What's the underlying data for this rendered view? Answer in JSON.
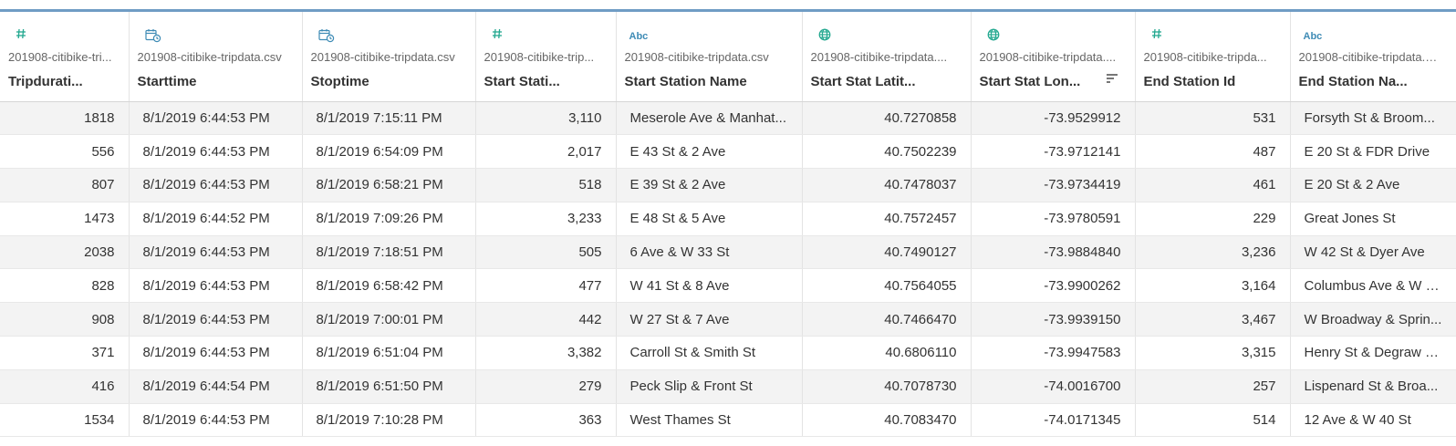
{
  "columns": [
    {
      "type": "number",
      "icon": "number-type-icon",
      "source": "201908-citibike-tri...",
      "name": "Tripdurati...",
      "align": "right"
    },
    {
      "type": "datetime",
      "icon": "datetime-type-icon",
      "source": "201908-citibike-tripdata.csv",
      "name": "Starttime",
      "align": "left"
    },
    {
      "type": "datetime",
      "icon": "datetime-type-icon",
      "source": "201908-citibike-tripdata.csv",
      "name": "Stoptime",
      "align": "left"
    },
    {
      "type": "number",
      "icon": "number-type-icon",
      "source": "201908-citibike-trip...",
      "name": "Start Stati...",
      "align": "right"
    },
    {
      "type": "string",
      "icon": "string-type-icon",
      "source": "201908-citibike-tripdata.csv",
      "name": "Start Station Name",
      "align": "left"
    },
    {
      "type": "geo",
      "icon": "globe-icon",
      "source": "201908-citibike-tripdata....",
      "name": "Start Stat Latit...",
      "align": "right"
    },
    {
      "type": "geo",
      "icon": "globe-icon",
      "source": "201908-citibike-tripdata....",
      "name": "Start Stat Lon...",
      "align": "right",
      "sorted": true
    },
    {
      "type": "number",
      "icon": "number-type-icon",
      "source": "201908-citibike-tripda...",
      "name": "End Station Id",
      "align": "right"
    },
    {
      "type": "string",
      "icon": "string-type-icon",
      "source": "201908-citibike-tripdata.csv",
      "name": "End Station Na...",
      "align": "left"
    }
  ],
  "string_icon_text": "Abc",
  "rows": [
    [
      "1818",
      "8/1/2019 6:44:53 PM",
      "8/1/2019 7:15:11 PM",
      "3,110",
      "Meserole Ave & Manhat...",
      "40.7270858",
      "-73.9529912",
      "531",
      "Forsyth St & Broom..."
    ],
    [
      "556",
      "8/1/2019 6:44:53 PM",
      "8/1/2019 6:54:09 PM",
      "2,017",
      "E 43 St & 2 Ave",
      "40.7502239",
      "-73.9712141",
      "487",
      "E 20 St & FDR Drive"
    ],
    [
      "807",
      "8/1/2019 6:44:53 PM",
      "8/1/2019 6:58:21 PM",
      "518",
      "E 39 St & 2 Ave",
      "40.7478037",
      "-73.9734419",
      "461",
      "E 20 St & 2 Ave"
    ],
    [
      "1473",
      "8/1/2019 6:44:52 PM",
      "8/1/2019 7:09:26 PM",
      "3,233",
      "E 48 St & 5 Ave",
      "40.7572457",
      "-73.9780591",
      "229",
      "Great Jones St"
    ],
    [
      "2038",
      "8/1/2019 6:44:53 PM",
      "8/1/2019 7:18:51 PM",
      "505",
      "6 Ave & W 33 St",
      "40.7490127",
      "-73.9884840",
      "3,236",
      "W 42 St & Dyer Ave"
    ],
    [
      "828",
      "8/1/2019 6:44:53 PM",
      "8/1/2019 6:58:42 PM",
      "477",
      "W 41 St & 8 Ave",
      "40.7564055",
      "-73.9900262",
      "3,164",
      "Columbus Ave & W 7..."
    ],
    [
      "908",
      "8/1/2019 6:44:53 PM",
      "8/1/2019 7:00:01 PM",
      "442",
      "W 27 St & 7 Ave",
      "40.7466470",
      "-73.9939150",
      "3,467",
      "W Broadway & Sprin..."
    ],
    [
      "371",
      "8/1/2019 6:44:53 PM",
      "8/1/2019 6:51:04 PM",
      "3,382",
      "Carroll St & Smith St",
      "40.6806110",
      "-73.9947583",
      "3,315",
      "Henry St & Degraw S..."
    ],
    [
      "416",
      "8/1/2019 6:44:54 PM",
      "8/1/2019 6:51:50 PM",
      "279",
      "Peck Slip & Front St",
      "40.7078730",
      "-74.0016700",
      "257",
      "Lispenard St & Broa..."
    ],
    [
      "1534",
      "8/1/2019 6:44:53 PM",
      "8/1/2019 7:10:28 PM",
      "363",
      "West Thames St",
      "40.7083470",
      "-74.0171345",
      "514",
      "12 Ave & W 40 St"
    ]
  ],
  "colors": {
    "accent_bar": "#6f9cc4",
    "number_icon": "#22a88f",
    "string_icon": "#3e8bb5",
    "alt_row": "#f3f3f3"
  }
}
